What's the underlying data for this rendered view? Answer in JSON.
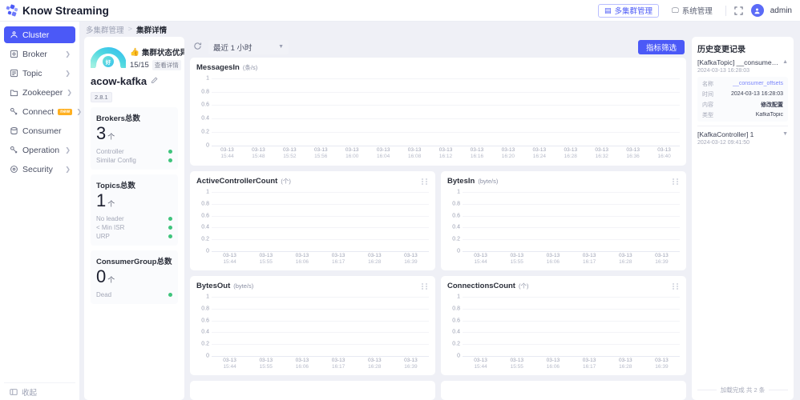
{
  "app": {
    "brand": "Know Streaming",
    "username": "admin"
  },
  "header": {
    "multi_cluster_label": "多集群管理",
    "system_label": "系统管理",
    "fullscreen_icon": "fullscreen-icon",
    "avatar_icon": "user-avatar-icon"
  },
  "sidebar": {
    "items": [
      {
        "label": "Cluster",
        "icon": "cluster-icon",
        "active": true,
        "chevron": false,
        "badge": ""
      },
      {
        "label": "Broker",
        "icon": "broker-icon",
        "active": false,
        "chevron": true,
        "badge": ""
      },
      {
        "label": "Topic",
        "icon": "topic-icon",
        "active": false,
        "chevron": true,
        "badge": ""
      },
      {
        "label": "Zookeeper",
        "icon": "zookeeper-icon",
        "active": false,
        "chevron": true,
        "badge": ""
      },
      {
        "label": "Connect",
        "icon": "connect-icon",
        "active": false,
        "chevron": true,
        "badge": "new"
      },
      {
        "label": "Consumer",
        "icon": "consumer-icon",
        "active": false,
        "chevron": false,
        "badge": ""
      },
      {
        "label": "Operation",
        "icon": "operation-icon",
        "active": false,
        "chevron": true,
        "badge": ""
      },
      {
        "label": "Security",
        "icon": "security-icon",
        "active": false,
        "chevron": true,
        "badge": ""
      }
    ],
    "collapse_label": "收起"
  },
  "breadcrumb": {
    "root": "多集群管理",
    "separator": ">",
    "current": "集群详情"
  },
  "cluster": {
    "health_label": "集群状态优异",
    "health_emoji": "👍",
    "settings_icon": "gear-icon",
    "score": "15/15",
    "detail_link": "查看详情",
    "gauge_badge": "好",
    "name": "acow-kafka",
    "edit_icon": "pencil-icon",
    "version": "2.8.1",
    "stats": [
      {
        "title": "Brokers总数",
        "value": "3",
        "unit": "个",
        "rows": [
          {
            "label": "Controller",
            "status": "ok"
          },
          {
            "label": "Similar Config",
            "status": "ok"
          }
        ]
      },
      {
        "title": "Topics总数",
        "value": "1",
        "unit": "个",
        "rows": [
          {
            "label": "No leader",
            "status": "ok"
          },
          {
            "label": "< Min ISR",
            "status": "ok"
          },
          {
            "label": "URP",
            "status": "ok"
          }
        ]
      },
      {
        "title": "ConsumerGroup总数",
        "value": "0",
        "unit": "个",
        "rows": [
          {
            "label": "Dead",
            "status": "ok"
          }
        ]
      }
    ]
  },
  "toolbar": {
    "refresh_icon": "refresh-icon",
    "time_range": "最近 1 小时",
    "chevron_icon": "chevron-down-icon",
    "filter_label": "指标筛选"
  },
  "charts": {
    "yticks": [
      "1",
      "0.8",
      "0.6",
      "0.4",
      "0.2",
      "0"
    ],
    "wide": {
      "title": "MessagesIn",
      "unit": "(条/s)",
      "xticks": [
        {
          "date": "03-13",
          "time": "15:44"
        },
        {
          "date": "03-13",
          "time": "15:48"
        },
        {
          "date": "03-13",
          "time": "15:52"
        },
        {
          "date": "03-13",
          "time": "15:56"
        },
        {
          "date": "03-13",
          "time": "16:00"
        },
        {
          "date": "03-13",
          "time": "16:04"
        },
        {
          "date": "03-13",
          "time": "16:08"
        },
        {
          "date": "03-13",
          "time": "16:12"
        },
        {
          "date": "03-13",
          "time": "16:16"
        },
        {
          "date": "03-13",
          "time": "16:20"
        },
        {
          "date": "03-13",
          "time": "16:24"
        },
        {
          "date": "03-13",
          "time": "16:28"
        },
        {
          "date": "03-13",
          "time": "16:32"
        },
        {
          "date": "03-13",
          "time": "16:36"
        },
        {
          "date": "03-13",
          "time": "16:40"
        }
      ]
    },
    "small_xticks": [
      {
        "date": "03-13",
        "time": "15:44"
      },
      {
        "date": "03-13",
        "time": "15:55"
      },
      {
        "date": "03-13",
        "time": "16:06"
      },
      {
        "date": "03-13",
        "time": "16:17"
      },
      {
        "date": "03-13",
        "time": "16:28"
      },
      {
        "date": "03-13",
        "time": "16:39"
      }
    ],
    "grid": [
      {
        "title": "ActiveControllerCount",
        "unit": "(个)",
        "drag_icon": "drag-handle-icon"
      },
      {
        "title": "BytesIn",
        "unit": "(byte/s)",
        "drag_icon": "drag-handle-icon"
      },
      {
        "title": "BytesOut",
        "unit": "(byte/s)",
        "drag_icon": "drag-handle-icon"
      },
      {
        "title": "ConnectionsCount",
        "unit": "(个)",
        "drag_icon": "drag-handle-icon"
      }
    ]
  },
  "chart_data": {
    "type": "line",
    "title": "MessagesIn (条/s)",
    "xlabel": "",
    "ylabel": "",
    "ylim": [
      0,
      1
    ],
    "yticks": [
      0,
      0.2,
      0.4,
      0.6,
      0.8,
      1
    ],
    "grid": true,
    "legend": "none",
    "x": [
      "15:44",
      "15:48",
      "15:52",
      "15:56",
      "16:00",
      "16:04",
      "16:08",
      "16:12",
      "16:16",
      "16:20",
      "16:24",
      "16:28",
      "16:32",
      "16:36",
      "16:40"
    ],
    "series": [
      {
        "name": "MessagesIn",
        "values": [
          0,
          0,
          0,
          0,
          0,
          0,
          0,
          0,
          0,
          0,
          0,
          0,
          0,
          0,
          0
        ]
      }
    ],
    "panels": [
      {
        "title": "MessagesIn (条/s)",
        "ylim": [
          0,
          1
        ],
        "values": [
          0,
          0,
          0,
          0,
          0,
          0,
          0,
          0,
          0,
          0,
          0,
          0,
          0,
          0,
          0
        ]
      },
      {
        "title": "ActiveControllerCount (个)",
        "ylim": [
          0,
          1
        ],
        "values": [
          0,
          0,
          0,
          0,
          0,
          0
        ]
      },
      {
        "title": "BytesIn (byte/s)",
        "ylim": [
          0,
          1
        ],
        "values": [
          0,
          0,
          0,
          0,
          0,
          0
        ]
      },
      {
        "title": "BytesOut (byte/s)",
        "ylim": [
          0,
          1
        ],
        "values": [
          0,
          0,
          0,
          0,
          0,
          0
        ]
      },
      {
        "title": "ConnectionsCount (个)",
        "ylim": [
          0,
          1
        ],
        "values": [
          0,
          0,
          0,
          0,
          0,
          0
        ]
      }
    ]
  },
  "history": {
    "title": "历史变更记录",
    "entries": [
      {
        "name": "[KafkaTopic] __consumer_off...",
        "time": "2024-03-13 16:28:03",
        "expanded": true,
        "caret": "▲",
        "rows": [
          {
            "key": "名称",
            "value": "__consumer_offsets",
            "style": "link"
          },
          {
            "key": "时间",
            "value": "2024-03-13 16:28:03",
            "style": "plain"
          },
          {
            "key": "内容",
            "value": "修改配置",
            "style": "bold"
          },
          {
            "key": "类型",
            "value": "KafkaTopic",
            "style": "plain"
          }
        ]
      },
      {
        "name": "[KafkaController] 1",
        "time": "2024-03-12 09:41:50",
        "expanded": false,
        "caret": "▼",
        "rows": []
      }
    ],
    "footer": "加载完成 共 2 条"
  },
  "colors": {
    "accent": "#4b59f7",
    "ok": "#3fc47c",
    "badge": "#ffb020",
    "page_bg": "#eff0f6"
  }
}
